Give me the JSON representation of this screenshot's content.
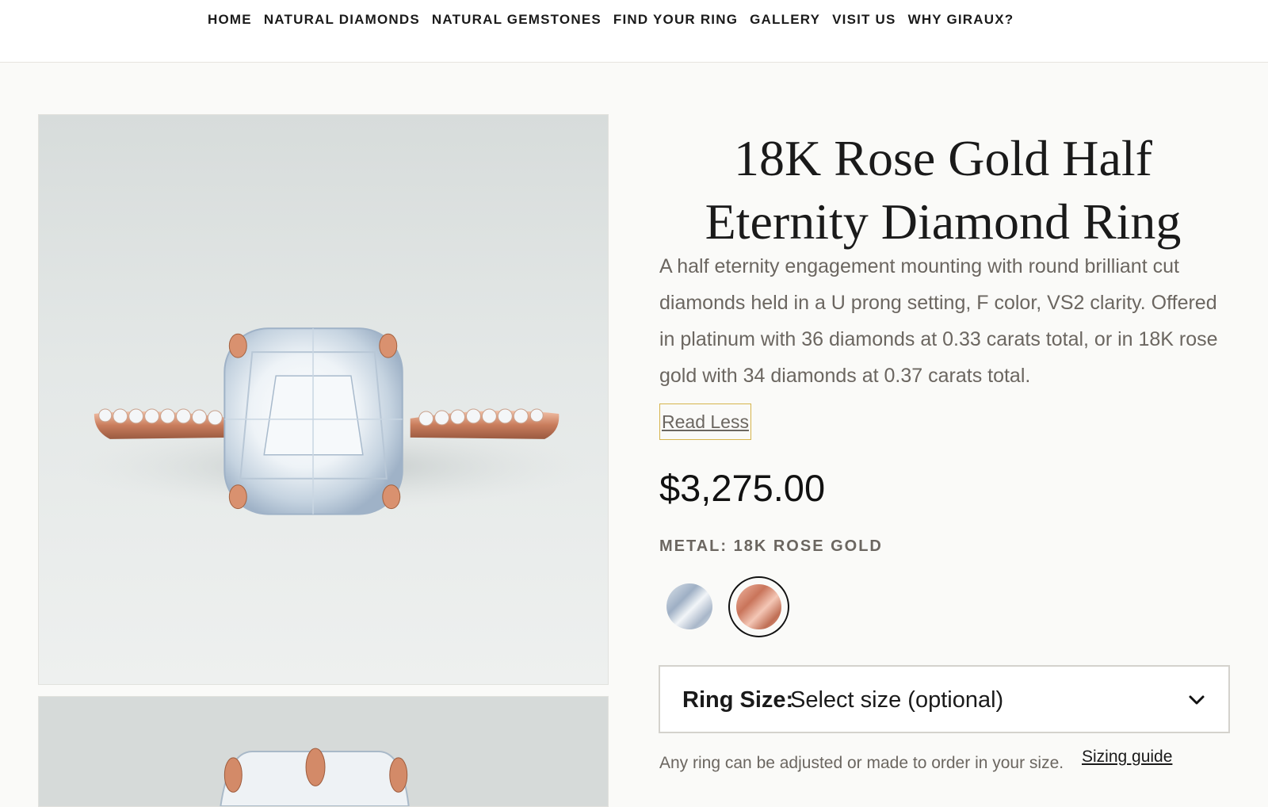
{
  "nav": {
    "items": [
      {
        "label": "HOME"
      },
      {
        "label": "NATURAL DIAMONDS"
      },
      {
        "label": "NATURAL GEMSTONES"
      },
      {
        "label": "FIND YOUR RING"
      },
      {
        "label": "GALLERY"
      },
      {
        "label": "VISIT US"
      },
      {
        "label": "WHY GIRAUX?"
      }
    ]
  },
  "product": {
    "title": "18K Rose Gold Half Eternity Diamond Ring",
    "description": "A half eternity engagement mounting with round brilliant cut diamonds held in a U prong setting, F color, VS2 clarity. Offered in platinum with 36 diamonds at 0.33 carats total, or in 18K rose gold with 34 diamonds at 0.37 carats total.",
    "read_less_label": "Read Less",
    "price": "$3,275.00",
    "metal_label": "METAL: 18K ROSE GOLD",
    "metal_options": [
      {
        "name": "Platinum",
        "selected": false,
        "color": "#b3c0d0"
      },
      {
        "name": "18K Rose Gold",
        "selected": true,
        "color": "#d98a72"
      }
    ],
    "ring_size": {
      "label": "Ring Size:",
      "value": "Select size (optional)"
    },
    "sizing_note": "Any ring can be adjusted or made to order in your size.",
    "sizing_guide_label": "Sizing guide"
  },
  "colors": {
    "background": "#fafaf8",
    "text": "#1a1a1a",
    "muted_text": "#6b6660",
    "focus_outline": "#d6b44c"
  }
}
